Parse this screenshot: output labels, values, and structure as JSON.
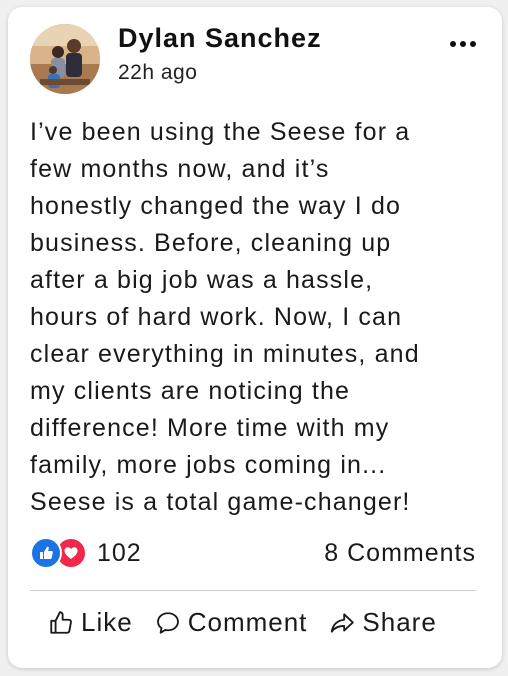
{
  "post": {
    "author": "Dylan Sanchez",
    "timestamp": "22h ago",
    "more_icon": "more-horizontal-icon",
    "body_lines": [
      "I’ve been using the Seese for a",
      "few months now, and it’s",
      "honestly changed the way I do",
      "business. Before, cleaning up",
      "after a big job was a hassle,",
      "hours of hard work. Now, I can",
      "clear everything in minutes, and",
      "my clients are noticing the",
      "difference! More time with my",
      "family, more jobs coming in...",
      "Seese is a total game-changer!"
    ]
  },
  "stats": {
    "reaction_icons": [
      "thumbs-up-icon",
      "heart-icon"
    ],
    "reactions_count": "102",
    "comments_label": "8 Comments"
  },
  "actions": {
    "like_label": "Like",
    "comment_label": "Comment",
    "share_label": "Share"
  },
  "colors": {
    "like_blue": "#1b74e4",
    "love_red": "#f02849",
    "text": "#1a1a1a"
  }
}
